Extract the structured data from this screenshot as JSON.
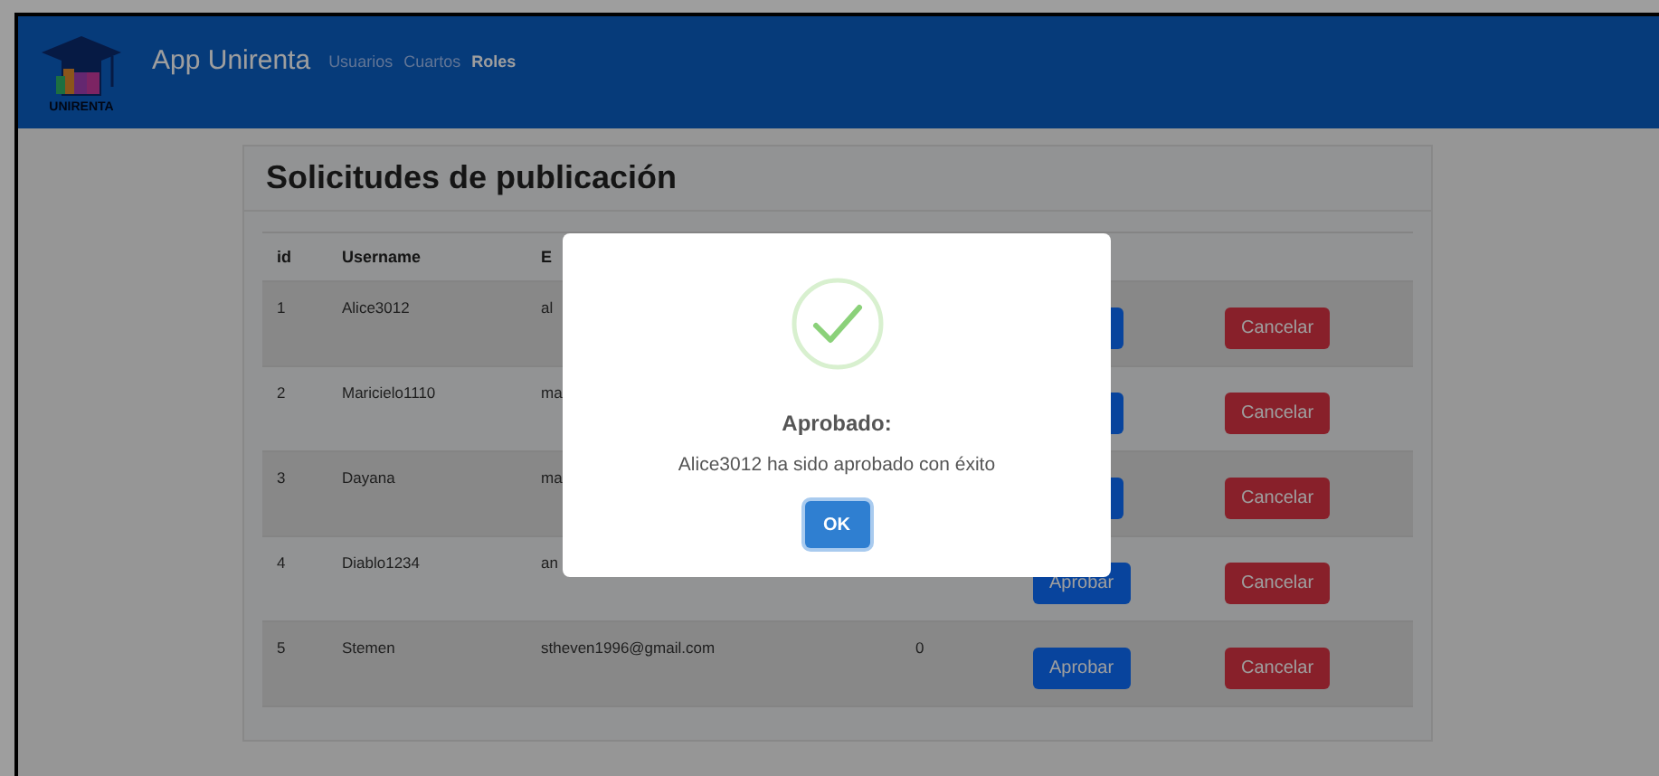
{
  "navbar": {
    "logo_text": "UNIRENTA",
    "brand": "App Unirenta",
    "links": [
      {
        "label": "Usuarios",
        "selected": false
      },
      {
        "label": "Cuartos",
        "selected": false
      },
      {
        "label": "Roles",
        "selected": true
      }
    ]
  },
  "card": {
    "title": "Solicitudes de publicación"
  },
  "table": {
    "columns": [
      "id",
      "Username",
      "E"
    ],
    "rows": [
      {
        "id": "1",
        "username": "Alice3012",
        "email": "al",
        "approve_label": null,
        "cancel_label": "Cancelar"
      },
      {
        "id": "2",
        "username": "Maricielo1110",
        "email": "ma",
        "approve_label": null,
        "cancel_label": "Cancelar"
      },
      {
        "id": "3",
        "username": "Dayana",
        "email": "ma",
        "approve_label": null,
        "cancel_label": "Cancelar"
      },
      {
        "id": "4",
        "username": "Diablo1234",
        "email": "an",
        "approve_label": "Aprobar",
        "cancel_label": "Cancelar"
      },
      {
        "id": "5",
        "username": "Stemen",
        "email": "stheven1996@gmail.com",
        "count": "0",
        "approve_label": "Aprobar",
        "cancel_label": "Cancelar"
      }
    ]
  },
  "dialog": {
    "title": "Aprobado:",
    "message": "Alice3012 ha sido aprobado con éxito",
    "button": "OK"
  }
}
